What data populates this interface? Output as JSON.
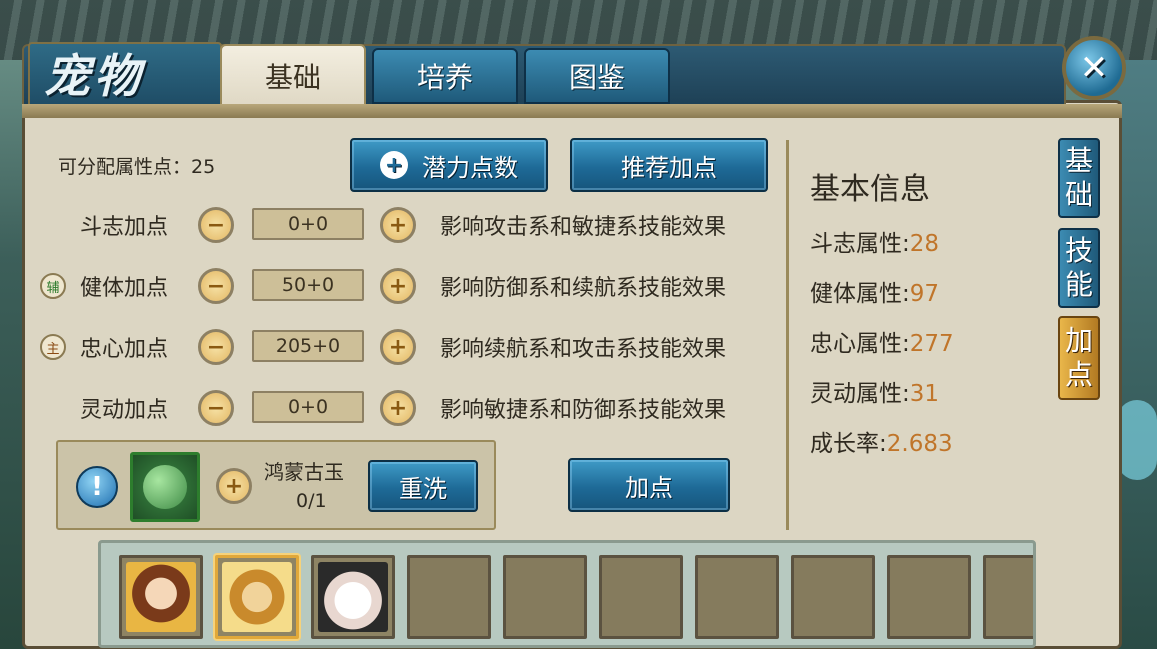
{
  "window": {
    "title": "宠物",
    "tabs": [
      {
        "label": "基础",
        "active": true
      },
      {
        "label": "培养",
        "active": false
      },
      {
        "label": "图鉴",
        "active": false
      }
    ],
    "close_icon": "close-x"
  },
  "left": {
    "points_label": "可分配属性点：25",
    "potential_button": "潜力点数",
    "recommend_button": "推荐加点",
    "rows": [
      {
        "badge": "",
        "label": "斗志加点",
        "value": "0+0",
        "desc": "影响攻击系和敏捷系技能效果"
      },
      {
        "badge": "辅",
        "label": "健体加点",
        "value": "50+0",
        "desc": "影响防御系和续航系技能效果"
      },
      {
        "badge": "主",
        "label": "忠心加点",
        "value": "205+0",
        "desc": "影响续航系和攻击系技能效果"
      },
      {
        "badge": "",
        "label": "灵动加点",
        "value": "0+0",
        "desc": "影响敏捷系和防御系技能效果"
      }
    ],
    "item": {
      "name": "鸿蒙古玉",
      "count": "0/1",
      "reset_button": "重洗"
    },
    "add_points_button": "加点"
  },
  "info": {
    "title": "基本信息",
    "lines": [
      {
        "label": "斗志属性:",
        "value": "28"
      },
      {
        "label": "健体属性:",
        "value": "97"
      },
      {
        "label": "忠心属性:",
        "value": "277"
      },
      {
        "label": "灵动属性:",
        "value": "31"
      },
      {
        "label": "成长率:",
        "value": "2.683"
      }
    ]
  },
  "side_tabs": [
    {
      "chars": [
        "基",
        "础"
      ],
      "active": false
    },
    {
      "chars": [
        "技",
        "能"
      ],
      "active": false
    },
    {
      "chars": [
        "加",
        "点"
      ],
      "active": true
    }
  ],
  "colors": {
    "accent_blue": "#1e6a97",
    "value_orange": "#c0752a",
    "panel_beige": "#dcd6c3"
  }
}
